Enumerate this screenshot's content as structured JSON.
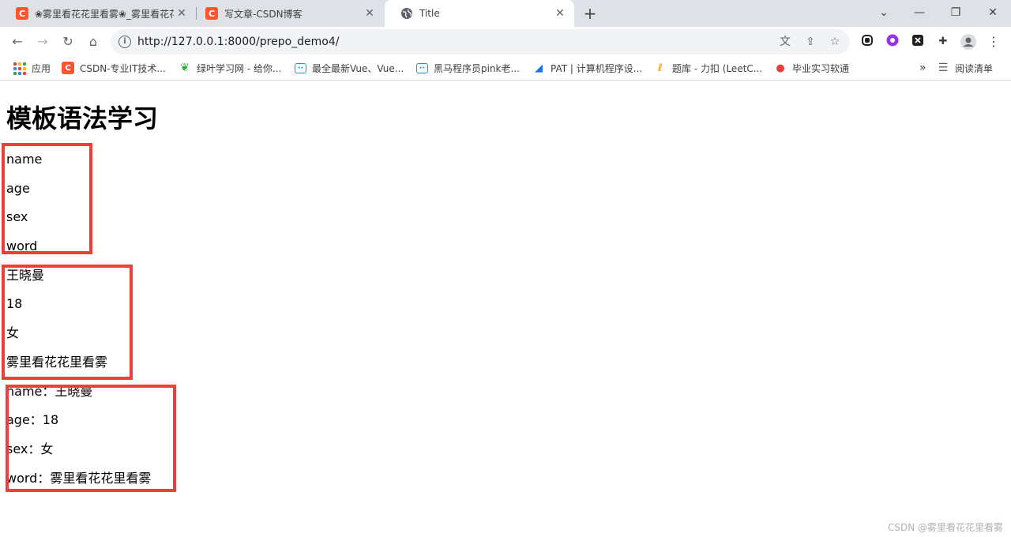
{
  "browser": {
    "tabs": [
      {
        "favicon": "C",
        "title": "❀雾里看花花里看雾❀_雾里看花花里看雾"
      },
      {
        "favicon": "C",
        "title": "写文章-CSDN博客"
      },
      {
        "favicon": "globe",
        "title": "Title"
      }
    ],
    "url": "http://127.0.0.1:8000/prepo_demo4/",
    "bookmarks": [
      {
        "label": "应用"
      },
      {
        "label": "CSDN-专业IT技术..."
      },
      {
        "label": "绿叶学习网 - 给你..."
      },
      {
        "label": "最全最新Vue、Vue..."
      },
      {
        "label": "黑马程序员pink老..."
      },
      {
        "label": "PAT | 计算机程序设..."
      },
      {
        "label": "题库 - 力扣 (LeetC..."
      },
      {
        "label": "毕业实习软通"
      }
    ],
    "overflow": "»",
    "reading_list": "阅读清单",
    "colors": {
      "accent_red": "#e8403a",
      "csdn": "#fc5531"
    }
  },
  "page": {
    "heading": "模板语法学习",
    "keys": [
      "name",
      "age",
      "sex",
      "word"
    ],
    "values": [
      "王晓曼",
      "18",
      "女",
      "雾里看花花里看雾"
    ],
    "pairs": [
      "name：王晓曼",
      "age：18",
      "sex：女",
      "word：雾里看花花里看雾"
    ],
    "watermark": "CSDN @雾里看花花里看雾"
  }
}
